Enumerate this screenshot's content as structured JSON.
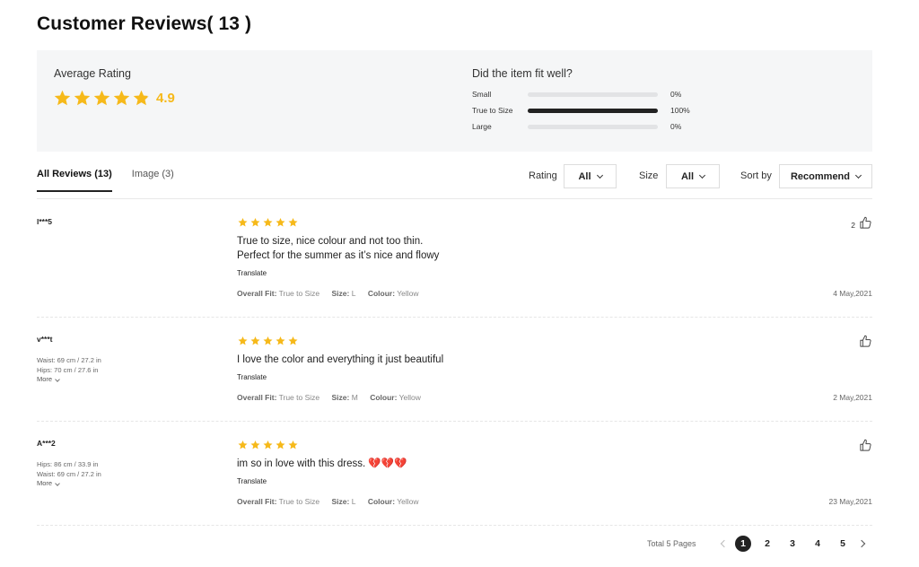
{
  "header": {
    "title": "Customer Reviews( 13 )"
  },
  "summary": {
    "average_label": "Average Rating",
    "average_value": "4.9",
    "rating_stars": 4.9,
    "fit_title": "Did the item fit well?",
    "fit": [
      {
        "label": "Small",
        "percent_text": "0%",
        "fraction": 0
      },
      {
        "label": "True to Size",
        "percent_text": "100%",
        "fraction": 1
      },
      {
        "label": "Large",
        "percent_text": "0%",
        "fraction": 0
      }
    ]
  },
  "tabs": [
    {
      "label": "All Reviews (13)",
      "active": true
    },
    {
      "label": "Image (3)",
      "active": false
    }
  ],
  "filters": {
    "rating_label": "Rating",
    "rating_value": "All",
    "size_label": "Size",
    "size_value": "All",
    "sort_label": "Sort by",
    "sort_value": "Recommend"
  },
  "reviews": [
    {
      "user": "l***5",
      "measurements": [],
      "more": "",
      "stars": 5,
      "text_lines": [
        "True to size, nice colour and not too thin.",
        "Perfect for the summer as it’s nice and flowy"
      ],
      "translate": "Translate",
      "fit_key": "Overall Fit:",
      "fit_val": "True to Size",
      "size_key": "Size:",
      "size_val": "L",
      "colour_key": "Colour:",
      "colour_val": "Yellow",
      "date": "4 May,2021",
      "likes": "2"
    },
    {
      "user": "v***t",
      "measurements": [
        "Waist: 69 cm / 27.2 in",
        "Hips: 70 cm / 27.6 in"
      ],
      "more": "More",
      "stars": 5,
      "text_lines": [
        "I love the color and everything it just beautiful"
      ],
      "translate": "Translate",
      "fit_key": "Overall Fit:",
      "fit_val": "True to Size",
      "size_key": "Size:",
      "size_val": "M",
      "colour_key": "Colour:",
      "colour_val": "Yellow",
      "date": "2 May,2021",
      "likes": ""
    },
    {
      "user": "A***2",
      "measurements": [
        "Hips: 86 cm / 33.9 in",
        "Waist: 69 cm / 27.2 in"
      ],
      "more": "More",
      "stars": 5,
      "text_lines": [
        "im so in love with this dress. 💔💔💔"
      ],
      "translate": "Translate",
      "fit_key": "Overall Fit:",
      "fit_val": "True to Size",
      "size_key": "Size:",
      "size_val": "L",
      "colour_key": "Colour:",
      "colour_val": "Yellow",
      "date": "23 May,2021",
      "likes": ""
    }
  ],
  "pagination": {
    "total_label": "Total 5 Pages",
    "pages": [
      "1",
      "2",
      "3",
      "4",
      "5"
    ],
    "current": "1"
  },
  "colors": {
    "star": "#f6b91a",
    "accent": "#222222",
    "panel": "#f5f6f7"
  },
  "icons": {
    "star": "star-icon",
    "like": "thumbs-up-icon",
    "prev": "chevron-left-icon",
    "next": "chevron-right-icon"
  }
}
